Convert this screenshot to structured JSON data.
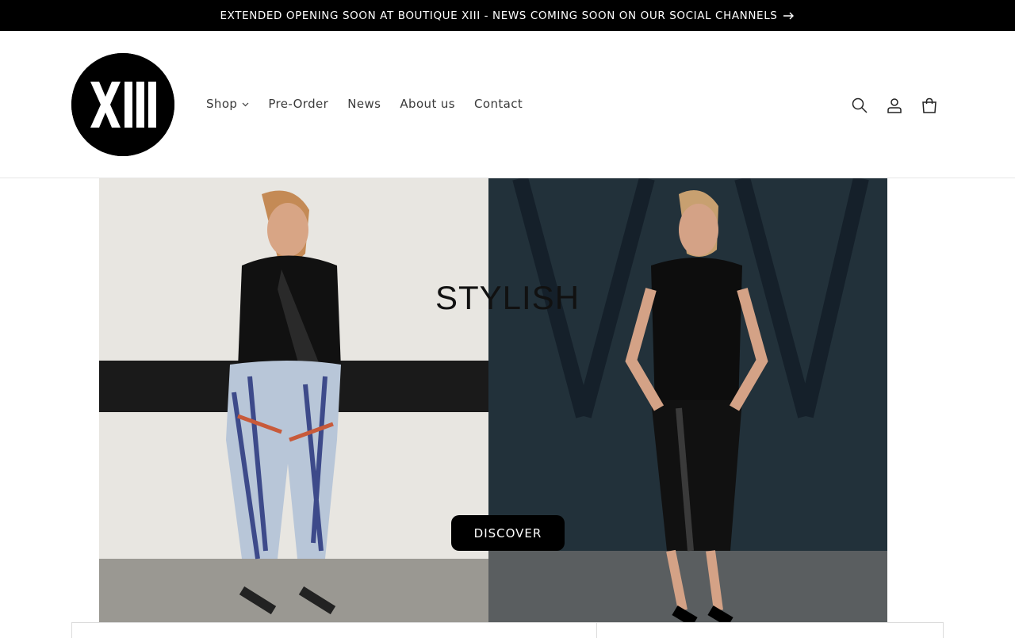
{
  "announcement": {
    "text": "EXTENDED OPENING SOON AT BOUTIQUE XIII - NEWS COMING SOON ON OUR SOCIAL CHANNELS",
    "icon": "arrow-right-icon"
  },
  "header": {
    "logo_text": "XIII",
    "nav": [
      {
        "label": "Shop",
        "has_dropdown": true
      },
      {
        "label": "Pre-Order"
      },
      {
        "label": "News"
      },
      {
        "label": "About us"
      },
      {
        "label": "Contact"
      }
    ],
    "icons": [
      "search-icon",
      "account-icon",
      "cart-icon"
    ]
  },
  "hero": {
    "title": "STYLISH",
    "button_label": "DISCOVER",
    "images": [
      "woman-printed-trousers-photo",
      "woman-black-satin-skirt-photo"
    ]
  },
  "colors": {
    "announcement_bg": "#000000",
    "button_bg": "#000000",
    "text": "#121212"
  }
}
